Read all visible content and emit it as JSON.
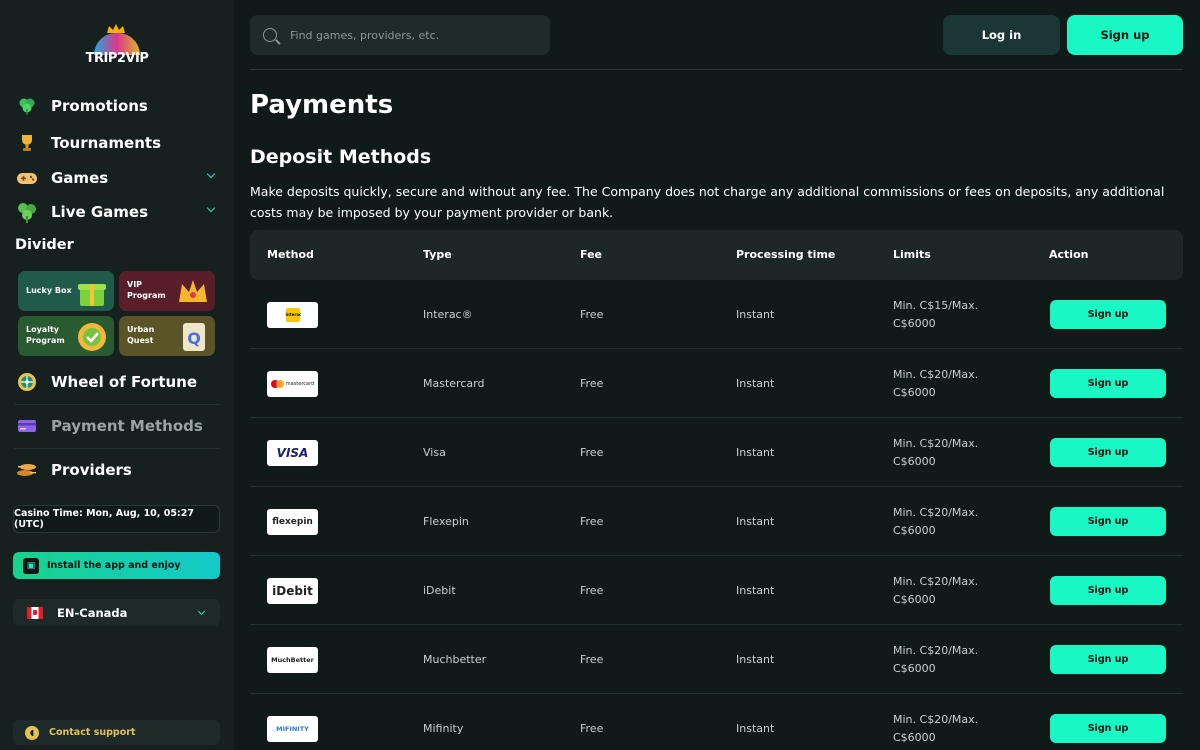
{
  "brand": {
    "name": "TRIP2VIP"
  },
  "sidebar": {
    "items": [
      {
        "label": "Promotions",
        "icon": "clover-icon"
      },
      {
        "label": "Tournaments",
        "icon": "trophy-icon"
      },
      {
        "label": "Games",
        "icon": "gamepad-icon"
      },
      {
        "label": "Live Games",
        "icon": "live-games-icon"
      }
    ],
    "divider_title": "Divider",
    "cards": [
      {
        "label": "Lucky Box"
      },
      {
        "label": "VIP Program"
      },
      {
        "label": "Loyalty Program"
      },
      {
        "label": "Urban Quest"
      }
    ],
    "items2": [
      {
        "label": "Wheel of Fortune",
        "icon": "wheel-icon"
      },
      {
        "label": "Payment Methods",
        "icon": "card-icon"
      },
      {
        "label": "Providers",
        "icon": "providers-icon"
      }
    ],
    "casino_time": "Casino Time: Mon, Aug, 10, 05:27 (UTC)",
    "install": "Install the app and enjoy",
    "language": "EN-Canada",
    "support": "Contact support"
  },
  "header": {
    "search_placeholder": "Find games, providers, etc.",
    "login": "Log in",
    "signup": "Sign up"
  },
  "main": {
    "title": "Payments",
    "section": "Deposit Methods",
    "description": "Make deposits quickly, secure and without any fee. The Company does not charge any additional commissions or fees on deposits, any additional costs may be imposed by your payment provider or bank.",
    "columns": [
      "Method",
      "Type",
      "Fee",
      "Processing time",
      "Limits",
      "Action"
    ],
    "rows": [
      {
        "logo": "interac",
        "type": "Interac®",
        "fee": "Free",
        "time": "Instant",
        "limit1": "Min. C$15/Max.",
        "limit2": "C$6000",
        "action": "Sign up"
      },
      {
        "logo": "mastercard",
        "type": "Mastercard",
        "fee": "Free",
        "time": "Instant",
        "limit1": "Min. C$20/Max.",
        "limit2": "C$6000",
        "action": "Sign up"
      },
      {
        "logo": "VISA",
        "type": "Visa",
        "fee": "Free",
        "time": "Instant",
        "limit1": "Min. C$20/Max.",
        "limit2": "C$6000",
        "action": "Sign up"
      },
      {
        "logo": "flexepin",
        "type": "Flexepin",
        "fee": "Free",
        "time": "Instant",
        "limit1": "Min. C$20/Max.",
        "limit2": "C$6000",
        "action": "Sign up"
      },
      {
        "logo": "iDebit",
        "type": "iDebit",
        "fee": "Free",
        "time": "Instant",
        "limit1": "Min. C$20/Max.",
        "limit2": "C$6000",
        "action": "Sign up"
      },
      {
        "logo": "MuchBetter",
        "type": "Muchbetter",
        "fee": "Free",
        "time": "Instant",
        "limit1": "Min. C$20/Max.",
        "limit2": "C$6000",
        "action": "Sign up"
      },
      {
        "logo": "MIFINITY",
        "type": "Mifinity",
        "fee": "Free",
        "time": "Instant",
        "limit1": "Min. C$20/Max.",
        "limit2": "C$6000",
        "action": "Sign up"
      }
    ]
  },
  "colors": {
    "accent": "#19f7c4",
    "background": "#0f1a19",
    "sidebar": "#15201f"
  }
}
